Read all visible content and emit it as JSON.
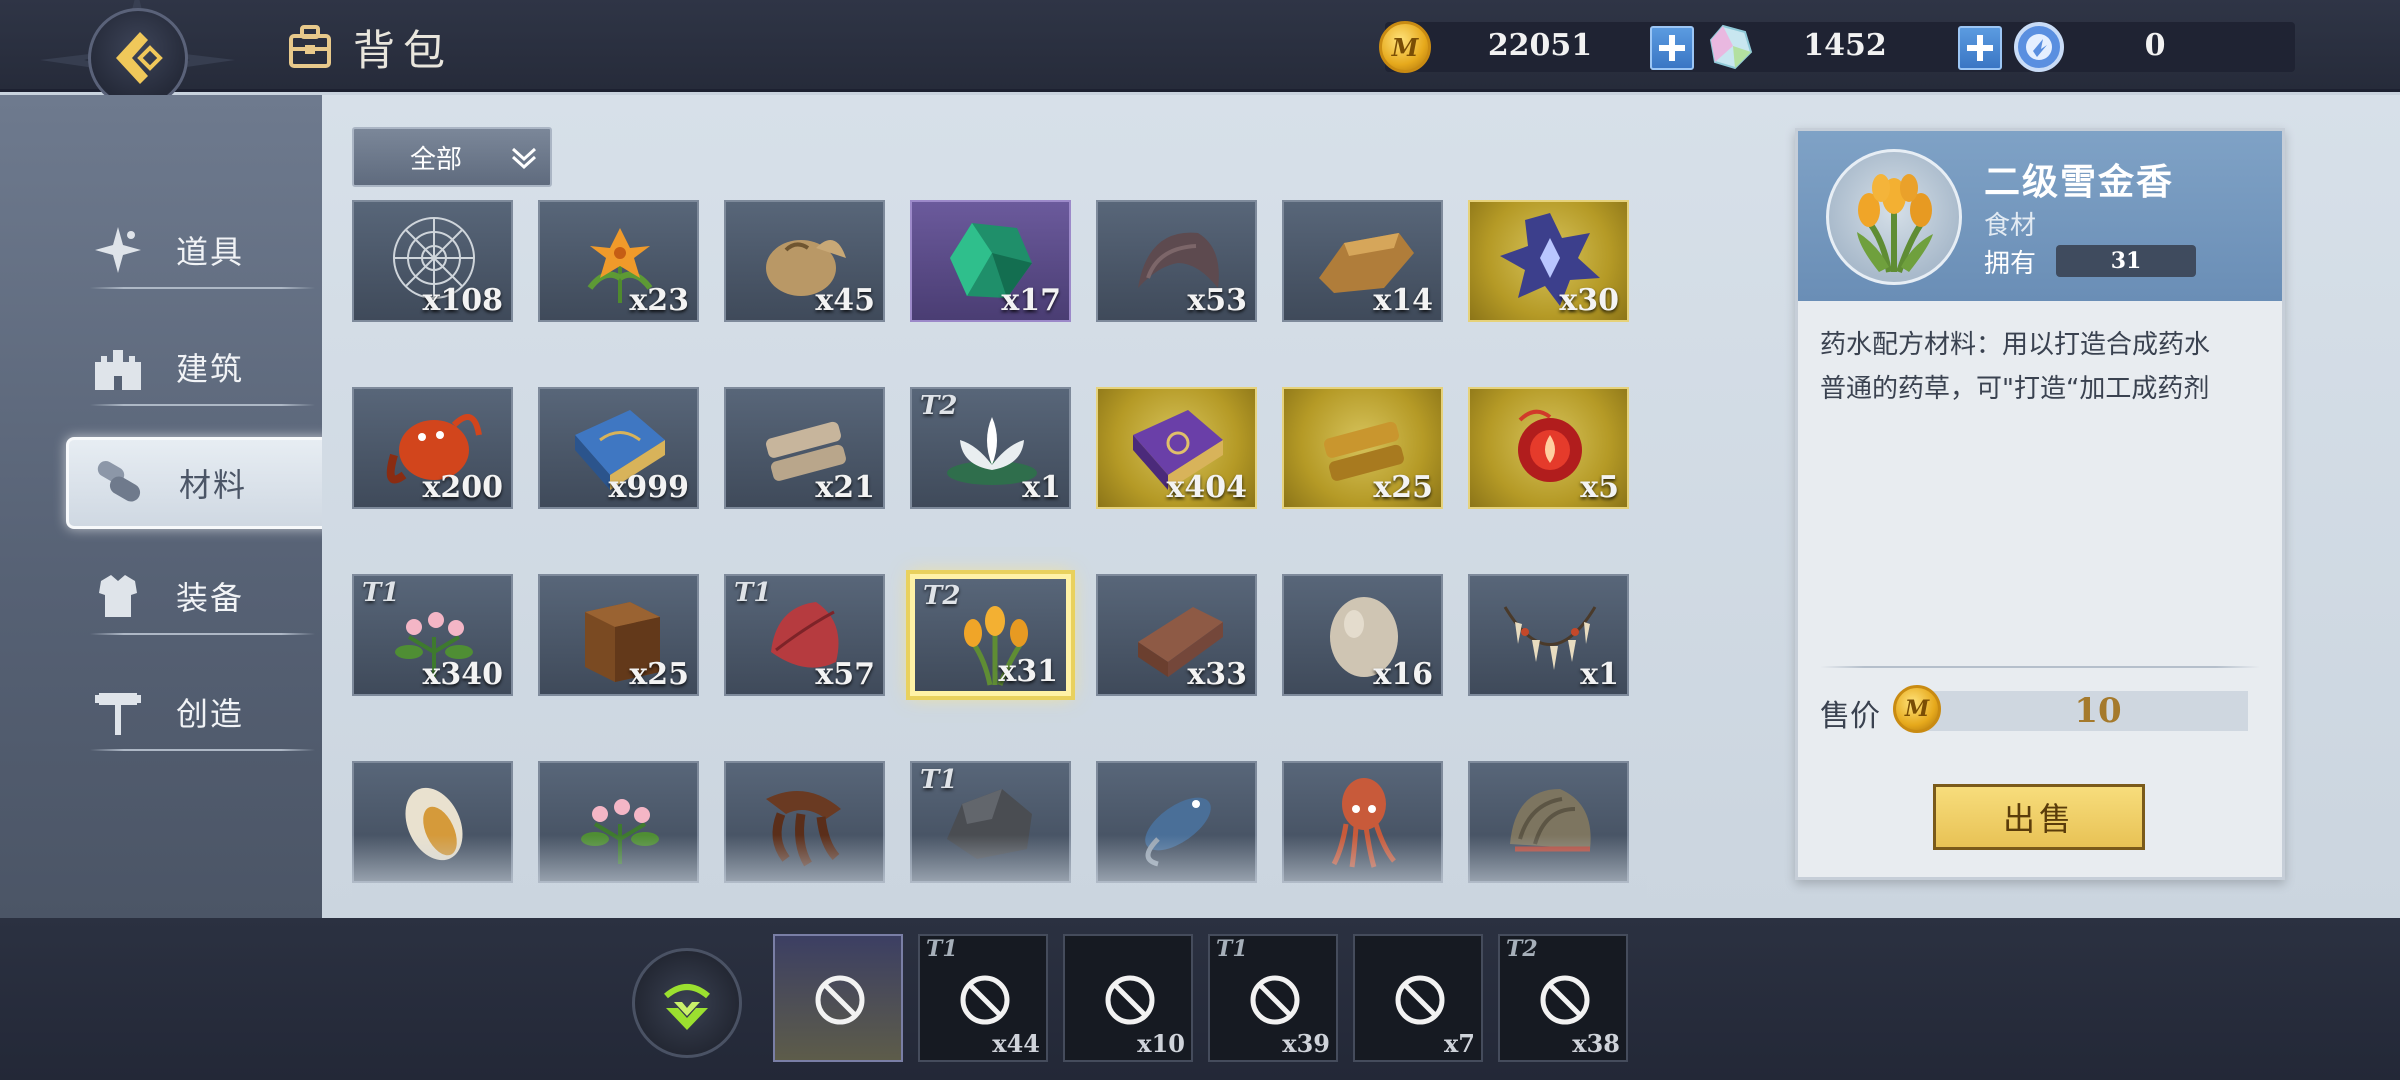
{
  "header": {
    "title": "背包",
    "currencies": [
      {
        "name": "gold-coin",
        "value": "22051"
      },
      {
        "name": "crystal",
        "value": "1452"
      },
      {
        "name": "blue-token",
        "value": "0"
      }
    ],
    "coin_glyph": "M"
  },
  "sidebar": {
    "items": [
      {
        "label": "道具",
        "icon": "sparkle-icon"
      },
      {
        "label": "建筑",
        "icon": "castle-icon"
      },
      {
        "label": "材料",
        "icon": "logs-icon",
        "active": true
      },
      {
        "label": "装备",
        "icon": "armor-icon"
      },
      {
        "label": "创造",
        "icon": "hammer-icon"
      }
    ]
  },
  "filter": {
    "label": "全部"
  },
  "grid": {
    "items": [
      {
        "count": "x108",
        "tier": "",
        "kind": "web",
        "style": "normal"
      },
      {
        "count": "x23",
        "tier": "",
        "kind": "lily",
        "style": "normal"
      },
      {
        "count": "x45",
        "tier": "",
        "kind": "sack",
        "style": "normal"
      },
      {
        "count": "x17",
        "tier": "",
        "kind": "emerald",
        "style": "purple"
      },
      {
        "count": "x53",
        "tier": "",
        "kind": "horn",
        "style": "normal"
      },
      {
        "count": "x14",
        "tier": "",
        "kind": "wood-chip",
        "style": "normal"
      },
      {
        "count": "x30",
        "tier": "",
        "kind": "snow-crystal",
        "style": "gold"
      },
      {
        "count": "x200",
        "tier": "",
        "kind": "crayfish",
        "style": "normal"
      },
      {
        "count": "x999",
        "tier": "",
        "kind": "blue-book",
        "style": "normal"
      },
      {
        "count": "x21",
        "tier": "",
        "kind": "scroll-bundle",
        "style": "normal"
      },
      {
        "count": "x1",
        "tier": "T2",
        "kind": "lotus",
        "style": "normal"
      },
      {
        "count": "x404",
        "tier": "",
        "kind": "purple-book",
        "style": "gold"
      },
      {
        "count": "x25",
        "tier": "",
        "kind": "gold-scroll",
        "style": "gold"
      },
      {
        "count": "x5",
        "tier": "",
        "kind": "fire-amulet",
        "style": "gold"
      },
      {
        "count": "x340",
        "tier": "T1",
        "kind": "pink-herb",
        "style": "normal"
      },
      {
        "count": "x25",
        "tier": "",
        "kind": "wood-block",
        "style": "normal"
      },
      {
        "count": "x57",
        "tier": "T1",
        "kind": "red-leaf",
        "style": "normal"
      },
      {
        "count": "x31",
        "tier": "T2",
        "kind": "tulip",
        "style": "normal",
        "selected": true
      },
      {
        "count": "x33",
        "tier": "",
        "kind": "brick",
        "style": "normal"
      },
      {
        "count": "x16",
        "tier": "",
        "kind": "egg",
        "style": "normal"
      },
      {
        "count": "x1",
        "tier": "",
        "kind": "tooth-necklace",
        "style": "normal"
      },
      {
        "count": "",
        "tier": "",
        "kind": "seed",
        "style": "normal"
      },
      {
        "count": "",
        "tier": "",
        "kind": "pink-herb",
        "style": "normal"
      },
      {
        "count": "",
        "tier": "",
        "kind": "claw",
        "style": "normal"
      },
      {
        "count": "",
        "tier": "T1",
        "kind": "rock",
        "style": "normal"
      },
      {
        "count": "",
        "tier": "",
        "kind": "fish",
        "style": "normal"
      },
      {
        "count": "",
        "tier": "",
        "kind": "squid",
        "style": "normal"
      },
      {
        "count": "",
        "tier": "",
        "kind": "shell",
        "style": "normal"
      }
    ]
  },
  "detail": {
    "name": "二级雪金香",
    "type": "食材",
    "owned_label": "拥有",
    "owned_value": "31",
    "description_lines": [
      "药水配方材料：用以打造合成药水",
      "普通的药草，可\"打造“加工成药剂"
    ],
    "price_label": "售价",
    "price_value": "10",
    "sell_label": "出售"
  },
  "quickbar": {
    "slots": [
      {
        "tier": "",
        "count": ""
      },
      {
        "tier": "T1",
        "count": "x44"
      },
      {
        "tier": "",
        "count": "x10"
      },
      {
        "tier": "T1",
        "count": "x39"
      },
      {
        "tier": "",
        "count": "x7"
      },
      {
        "tier": "T2",
        "count": "x38"
      }
    ]
  },
  "colors": {
    "accent_gold": "#e8c255",
    "selected_border": "#fff2a6",
    "plus_blue": "#3a76c4"
  }
}
